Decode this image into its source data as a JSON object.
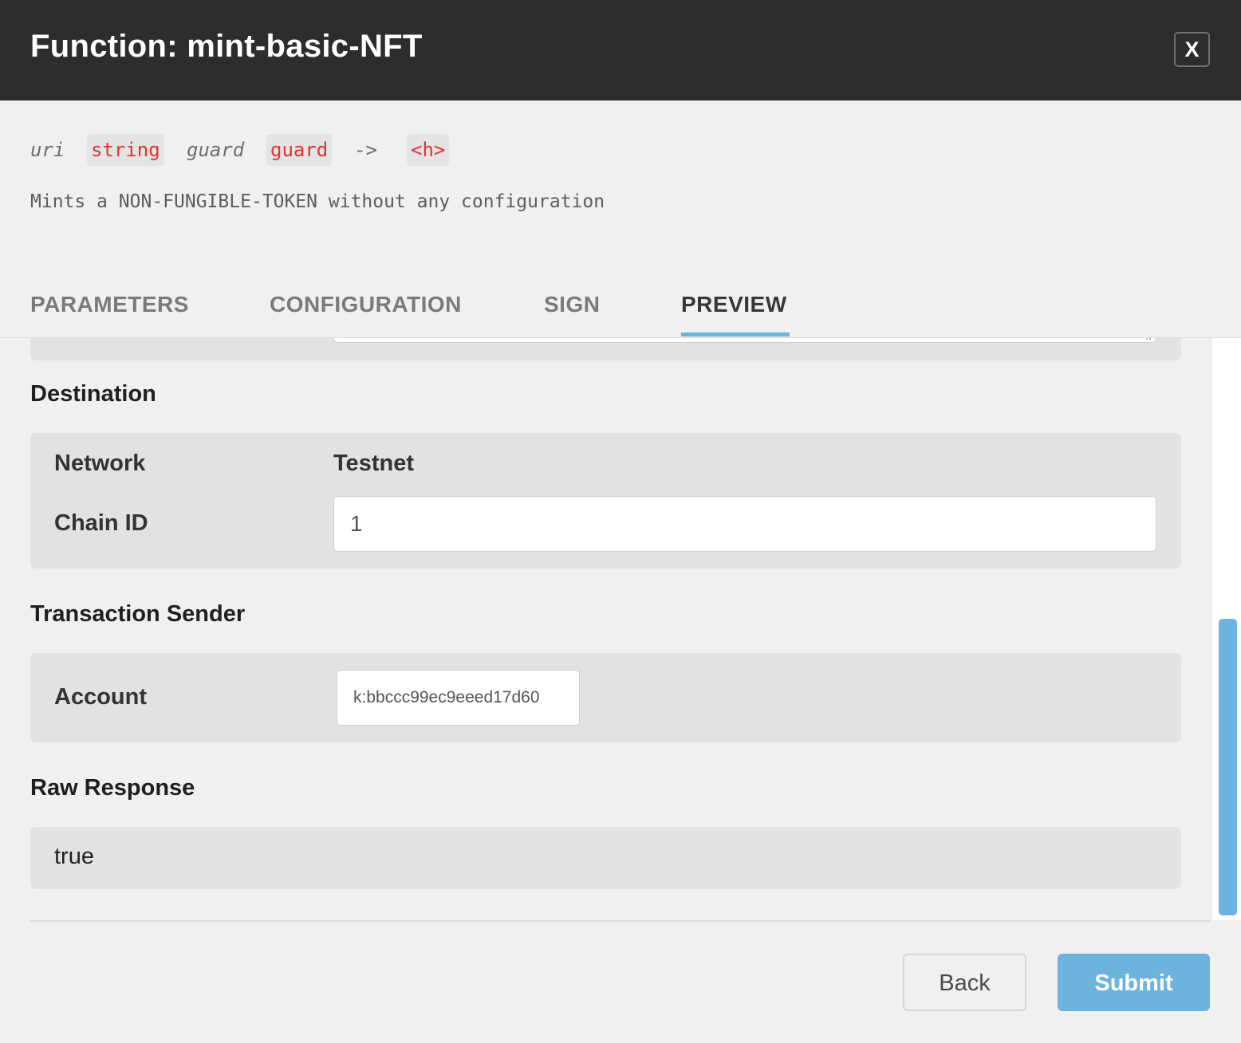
{
  "dialog": {
    "title": "Function: mint-basic-NFT",
    "close_label": "X"
  },
  "signature": {
    "params": [
      {
        "name": "uri",
        "type": "string"
      },
      {
        "name": "guard",
        "type": "guard"
      }
    ],
    "arrow": "->",
    "return_type": "<h>"
  },
  "description": "Mints a NON-FUNGIBLE-TOKEN without any configuration",
  "tabs": [
    {
      "label": "PARAMETERS",
      "active": false
    },
    {
      "label": "CONFIGURATION",
      "active": false
    },
    {
      "label": "SIGN",
      "active": false
    },
    {
      "label": "PREVIEW",
      "active": true
    }
  ],
  "destination": {
    "title": "Destination",
    "network_label": "Network",
    "network_value": "Testnet",
    "chain_label": "Chain ID",
    "chain_value": "1"
  },
  "sender": {
    "title": "Transaction Sender",
    "account_label": "Account",
    "account_value": "k:bbccc99ec9eeed17d60"
  },
  "raw_response": {
    "title": "Raw Response",
    "value": "true"
  },
  "footer": {
    "back_label": "Back",
    "submit_label": "Submit"
  },
  "colors": {
    "header_bg": "#2d2d2f",
    "accent": "#6cb3de",
    "type_red": "#e0342c",
    "panel_bg": "#e2e2e2"
  }
}
